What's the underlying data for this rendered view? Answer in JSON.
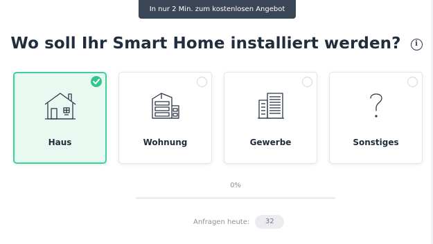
{
  "banner": {
    "text": "In nur 2 Min. zum kostenlosen Angebot"
  },
  "question": {
    "title": "Wo soll Ihr Smart Home installiert werden?",
    "info_icon": "info-icon"
  },
  "options": [
    {
      "label": "Haus",
      "icon": "house-icon",
      "selected": true
    },
    {
      "label": "Wohnung",
      "icon": "apartment-building-icon",
      "selected": false
    },
    {
      "label": "Gewerbe",
      "icon": "office-building-icon",
      "selected": false
    },
    {
      "label": "Sonstiges",
      "icon": "question-mark-icon",
      "selected": false
    }
  ],
  "progress": {
    "text": "0%",
    "value": 0
  },
  "requests": {
    "label": "Anfragen heute:",
    "count": "32"
  },
  "colors": {
    "accent": "#3ad29a",
    "selected_bg": "#e8f9f1",
    "banner_bg": "#3a4656",
    "text": "#1f2d3d",
    "muted": "#8a929c"
  }
}
